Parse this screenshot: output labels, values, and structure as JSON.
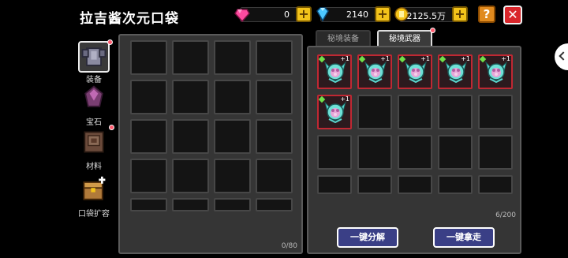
{
  "header": {
    "title": "拉吉酱次元口袋",
    "gems": "0",
    "diamonds": "2140",
    "coins": "2125.5万",
    "help_label": "?",
    "close_label": "✕"
  },
  "sidebar": {
    "items": [
      {
        "label": "装备",
        "icon": "armor-icon",
        "active": true,
        "dot": true
      },
      {
        "label": "宝石",
        "icon": "gem-icon",
        "active": false,
        "dot": false
      },
      {
        "label": "材料",
        "icon": "book-icon",
        "active": false,
        "dot": true
      },
      {
        "label": "口袋扩容",
        "icon": "chest-icon",
        "active": false,
        "dot": false
      }
    ]
  },
  "left_panel": {
    "count": "0/80"
  },
  "tabs": {
    "tab1": "秘境装备",
    "tab2": "秘境武器"
  },
  "right_panel": {
    "count": "6/200",
    "item_plus": "+1",
    "items_filled": 6,
    "btn_decompose": "一键分解",
    "btn_take_all": "一键拿走"
  },
  "colors": {
    "accent_blue": "#3a3f86",
    "rare_border": "#c02833",
    "gold": "#f3c31a"
  }
}
